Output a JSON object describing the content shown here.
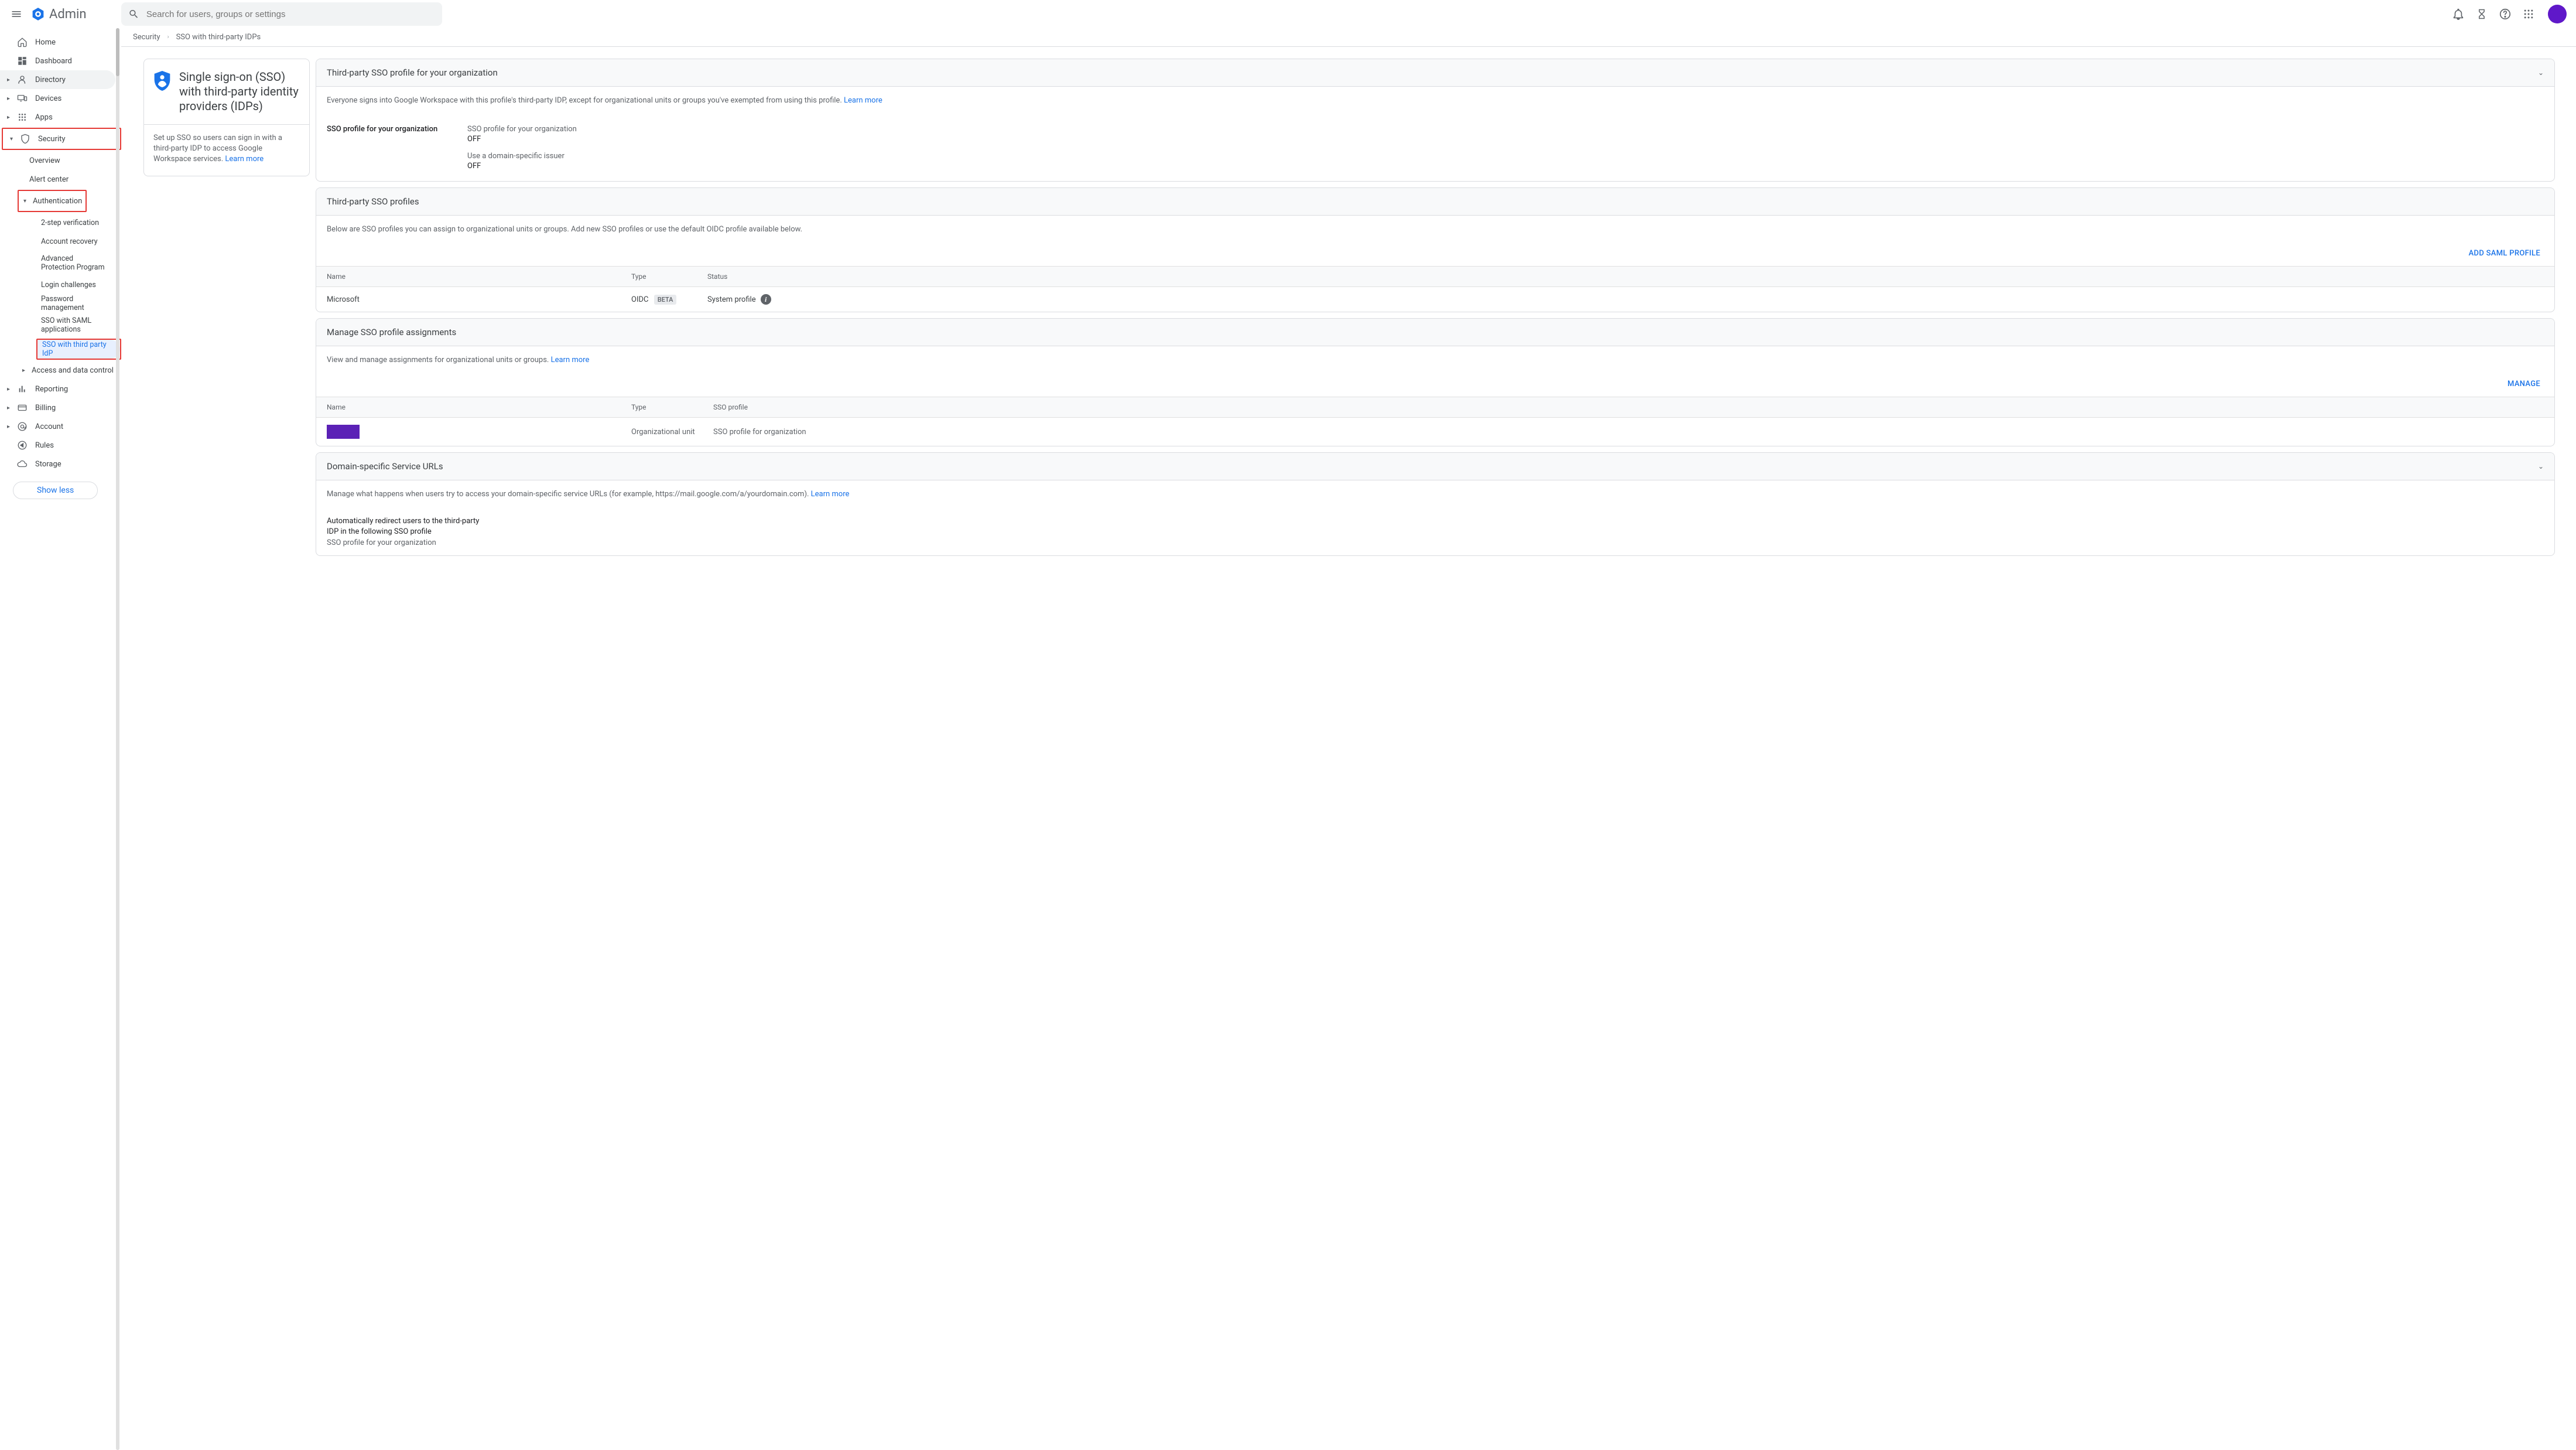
{
  "header": {
    "product": "Admin",
    "search_placeholder": "Search for users, groups or settings"
  },
  "breadcrumb": {
    "root": "Security",
    "current": "SSO with third-party IDPs"
  },
  "sidebar": {
    "home": "Home",
    "dashboard": "Dashboard",
    "directory": "Directory",
    "devices": "Devices",
    "apps": "Apps",
    "security": "Security",
    "overview": "Overview",
    "alert_center": "Alert center",
    "authentication": "Authentication",
    "two_step": "2-step verification",
    "account_recovery": "Account recovery",
    "adv_protection": "Advanced Protection Program",
    "login_challenges": "Login challenges",
    "password_mgmt": "Password management",
    "sso_saml": "SSO with SAML applications",
    "sso_third": "SSO with third party IdP",
    "access_data": "Access and data control",
    "reporting": "Reporting",
    "billing": "Billing",
    "account": "Account",
    "rules": "Rules",
    "storage": "Storage",
    "show_less": "Show less"
  },
  "intro_card": {
    "title": "Single sign-on (SSO) with third-party identity providers (IDPs)",
    "desc": "Set up SSO so users can sign in with a third-party IDP to access Google Workspace services. ",
    "learn": "Learn more"
  },
  "panels": {
    "org_profile": {
      "title": "Third-party SSO profile for your organization",
      "desc": "Everyone signs into Google Workspace with this profile's third-party IDP, except for organizational units or groups you've exempted from using this profile. ",
      "learn": "Learn more",
      "label": "SSO profile for your organization",
      "v1_label": "SSO profile for your organization",
      "v1_val": "OFF",
      "v2_label": "Use a domain-specific issuer",
      "v2_val": "OFF"
    },
    "profiles": {
      "title": "Third-party SSO profiles",
      "desc": "Below are SSO profiles you can assign to organizational units or groups. Add new SSO profiles or use the default OIDC profile available below.",
      "action": "ADD SAML PROFILE",
      "col_name": "Name",
      "col_type": "Type",
      "col_status": "Status",
      "row1_name": "Microsoft",
      "row1_type": "OIDC",
      "row1_beta": "BETA",
      "row1_status": "System profile"
    },
    "assignments": {
      "title": "Manage SSO profile assignments",
      "desc": "View and manage assignments for organizational units or groups. ",
      "learn": "Learn more",
      "action": "MANAGE",
      "col_name": "Name",
      "col_type": "Type",
      "col_sso": "SSO profile",
      "row1_type": "Organizational unit",
      "row1_sso": "SSO profile for organization"
    },
    "domain": {
      "title": "Domain-specific Service URLs",
      "desc": "Manage what happens when users try to access your domain-specific service URLs (for example, https://mail.google.com/a/yourdomain.com). ",
      "learn": "Learn more",
      "auto_strong": "Automatically redirect users to the third-party IDP in the following SSO profile",
      "auto_sub": "SSO profile for your organization"
    }
  }
}
